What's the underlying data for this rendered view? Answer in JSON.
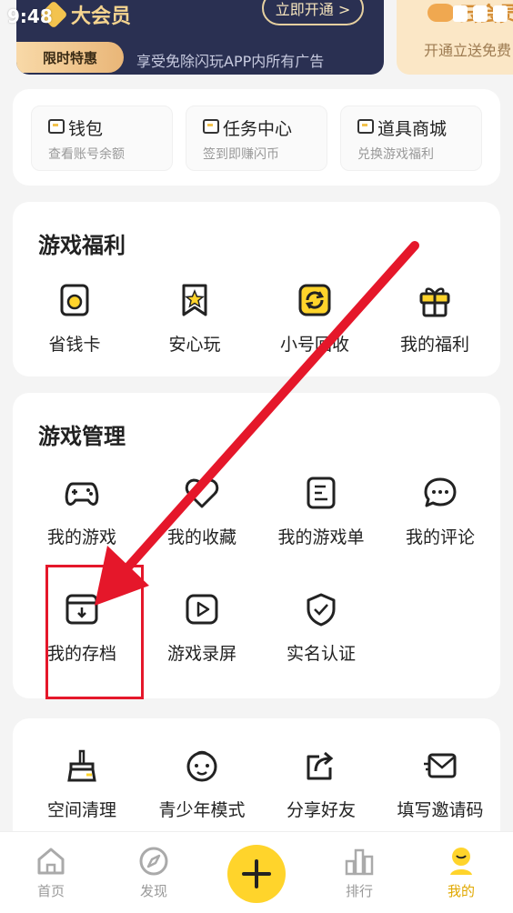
{
  "status": {
    "time": "9:48"
  },
  "vip": {
    "title": "大会员",
    "open_button": "立即开通 >",
    "badge": "限时特惠",
    "description": "享受免除闪玩APP内所有广告"
  },
  "cloud": {
    "title": "云会员",
    "description": "开通立送免费"
  },
  "quick_links": [
    {
      "label": "钱包",
      "sub": "查看账号余额"
    },
    {
      "label": "任务中心",
      "sub": "签到即赚闪币"
    },
    {
      "label": "道具商城",
      "sub": "兑换游戏福利"
    }
  ],
  "benefits": {
    "title": "游戏福利",
    "items": [
      {
        "label": "省钱卡",
        "icon": "savings-card-icon"
      },
      {
        "label": "安心玩",
        "icon": "star-badge-icon"
      },
      {
        "label": "小号回收",
        "icon": "recycle-icon"
      },
      {
        "label": "我的福利",
        "icon": "gift-icon"
      }
    ]
  },
  "management": {
    "title": "游戏管理",
    "items": [
      {
        "label": "我的游戏",
        "icon": "gamepad-icon"
      },
      {
        "label": "我的收藏",
        "icon": "heart-icon"
      },
      {
        "label": "我的游戏单",
        "icon": "list-icon"
      },
      {
        "label": "我的评论",
        "icon": "comment-icon"
      },
      {
        "label": "我的存档",
        "icon": "archive-icon"
      },
      {
        "label": "游戏录屏",
        "icon": "record-icon"
      },
      {
        "label": "实名认证",
        "icon": "shield-check-icon"
      }
    ]
  },
  "tools": {
    "items": [
      {
        "label": "空间清理",
        "icon": "broom-icon"
      },
      {
        "label": "青少年模式",
        "icon": "child-icon"
      },
      {
        "label": "分享好友",
        "icon": "share-icon"
      },
      {
        "label": "填写邀请码",
        "icon": "mail-icon"
      }
    ]
  },
  "nav": {
    "items": [
      {
        "label": "首页",
        "icon": "home-icon"
      },
      {
        "label": "发现",
        "icon": "compass-icon"
      },
      {
        "label": "排行",
        "icon": "ranking-icon"
      },
      {
        "label": "我的",
        "icon": "profile-icon"
      }
    ],
    "active": "我的"
  },
  "colors": {
    "accent": "#ffd42b",
    "vip_bg": "#2a3052",
    "annotation": "#e5172a"
  }
}
